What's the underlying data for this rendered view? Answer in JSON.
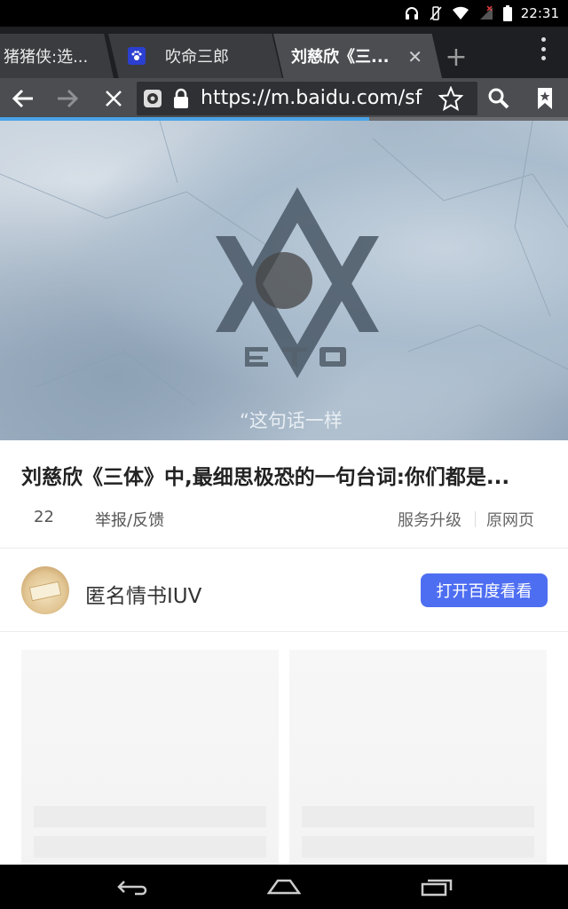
{
  "status_bar": {
    "time": "22:31",
    "icons": [
      "headset-icon",
      "vibrate-icon",
      "wifi-icon",
      "signal-icon",
      "battery-icon"
    ]
  },
  "tabs": [
    {
      "label": "猪猪侠:选...",
      "active": false
    },
    {
      "label": "吹命三郎",
      "active": false,
      "favicon": "paw-icon"
    },
    {
      "label": "刘慈欣《三...",
      "active": true,
      "close": "✕"
    }
  ],
  "tab_strip": {
    "new_tab": "+"
  },
  "toolbar": {
    "url": "https://m.baidu.com/sf",
    "icons": [
      "back-icon",
      "forward-icon",
      "stop-icon",
      "site-icon",
      "lock-icon",
      "star-icon",
      "search-icon",
      "bookmark-icon"
    ]
  },
  "page_load_progress": 0.65,
  "video": {
    "caption": "“这句话一样"
  },
  "article": {
    "title": "刘慈欣《三体》中,最细思极恐的一句台词:你们都是...",
    "count": "22",
    "report": "举报/反馈",
    "upgrade": "服务升级",
    "original": "原网页"
  },
  "author": {
    "name": "匿名情书IUV",
    "open_button": "打开百度看看"
  },
  "colors": {
    "accent": "#4e6ef2",
    "progress": "#4aa3e8",
    "toolbar": "#4b4d51"
  },
  "nav_bar": {
    "icons": [
      "back-nav-icon",
      "home-nav-icon",
      "recents-nav-icon"
    ]
  }
}
